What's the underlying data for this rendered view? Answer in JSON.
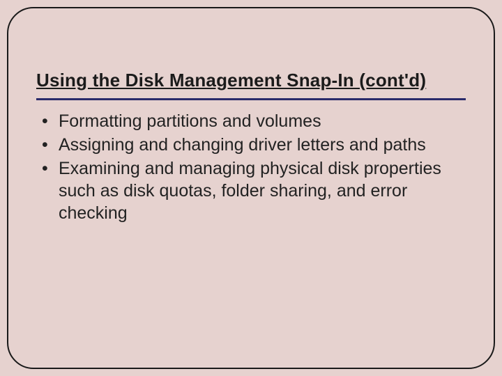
{
  "slide": {
    "title": "Using the Disk Management Snap-In (cont'd)",
    "bullets": [
      "Formatting partitions and volumes",
      "Assigning and changing driver letters and paths",
      "Examining and managing physical disk properties such as disk quotas, folder sharing, and error checking"
    ]
  }
}
